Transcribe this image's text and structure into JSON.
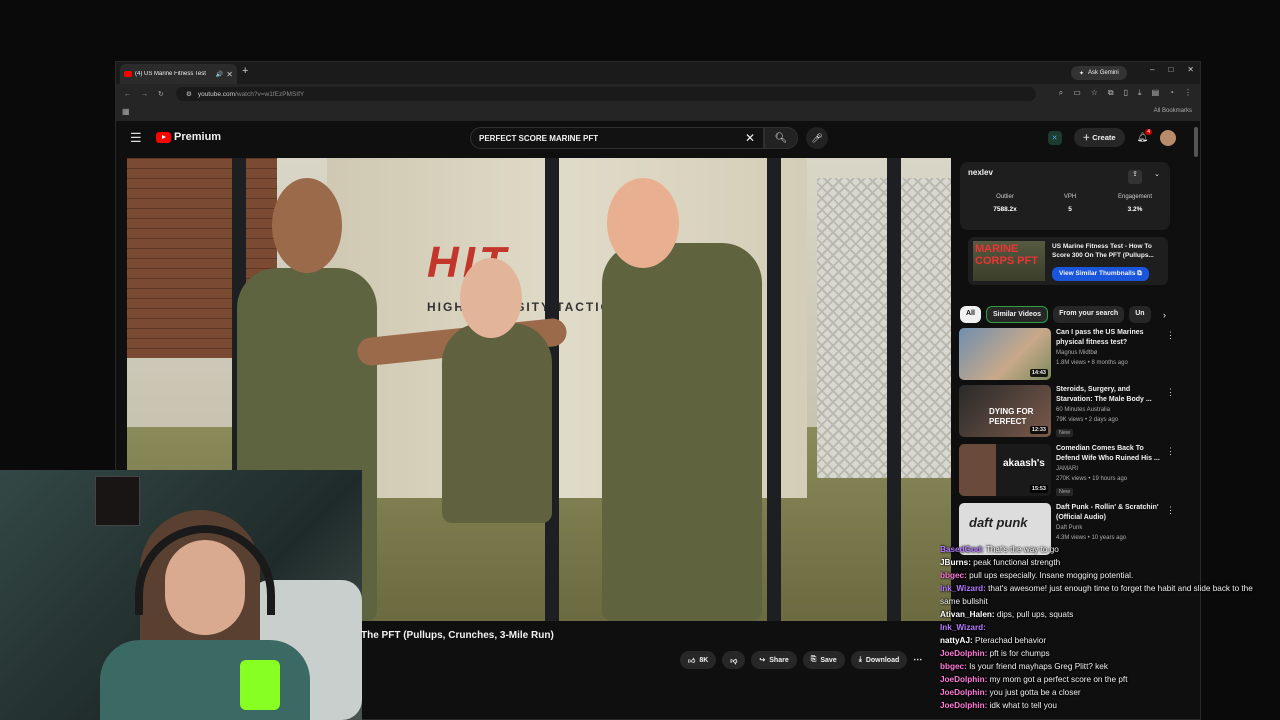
{
  "browser": {
    "tab_title": "(4) US Marine Fitness Test",
    "new_tab": "+",
    "gemini": "Ask Gemini",
    "url_host": "youtube.com",
    "url_path": "/watch?v=w1fEzPMSIfY",
    "all_bookmarks": "All Bookmarks",
    "window_controls": [
      "–",
      "□",
      "✕"
    ]
  },
  "youtube": {
    "logo": "Premium",
    "search_value": "PERFECT SCORE MARINE PFT",
    "create_label": "Create",
    "notif_count": "4",
    "video_title": "The PFT (Pullups, Crunches, 3-Mile Run)",
    "wall_text": "HIT",
    "wall_subtext": "HIGH INTENSITY TACTICAL",
    "actions": {
      "like": "8K",
      "share": "Share",
      "save": "Save",
      "download": "Download"
    }
  },
  "extension": {
    "logo": "nexlev",
    "stats": [
      {
        "label": "Outlier",
        "value": "7588.2x"
      },
      {
        "label": "VPH",
        "value": "5"
      },
      {
        "label": "Engagement",
        "value": "3.2%"
      }
    ],
    "similar": {
      "thumb_text": "MARINE CORPS PFT",
      "title": "US Marine Fitness Test - How To Score 300 On The PFT (Pullups...",
      "button": "View Similar Thumbnails"
    }
  },
  "chips": [
    "All",
    "Similar Videos",
    "From your search",
    "Un"
  ],
  "recommendations": [
    {
      "title": "Can I pass the US Marines physical fitness test?",
      "channel": "Magnus Midtbø",
      "meta": "1.8M views • 8 months ago",
      "duration": "14:43",
      "thumb_text": "",
      "new": ""
    },
    {
      "title": "Steroids, Surgery, and Starvation: The Male Body ...",
      "channel": "60 Minutes Australia",
      "meta": "79K views • 2 days ago",
      "duration": "12:33",
      "thumb_text": "DYING FOR PERFECT",
      "new": "New"
    },
    {
      "title": "Comedian Comes Back To Defend Wife Who Ruined His ...",
      "channel": "JAMARI",
      "meta": "270K views • 19 hours ago",
      "duration": "15:53",
      "thumb_text": "akaash's",
      "new": "New"
    },
    {
      "title": "Daft Punk - Rollin' & Scratchin' (Official Audio)",
      "channel": "Daft Punk",
      "meta": "4.3M views • 10 years ago",
      "duration": "",
      "thumb_text": "daft punk",
      "new": ""
    }
  ],
  "chat": [
    {
      "name": "BasedGod",
      "text": "That's the way to go",
      "color": "#b67bff"
    },
    {
      "name": "JBurns",
      "text": "peak functional strength",
      "color": "#ffffff"
    },
    {
      "name": "bbgec",
      "text": "pull ups especially. Insane mogging potential.",
      "color": "#ff7ad9"
    },
    {
      "name": "Ink_Wizard",
      "text": "that's awesome! just enough time to forget the habit and slide back to the same bullshit",
      "color": "#b67bff"
    },
    {
      "name": "Ativan_Halen",
      "text": "dips, pull ups, squats",
      "color": "#ffffff"
    },
    {
      "name": "Ink_Wizard",
      "text": "",
      "color": "#b67bff"
    },
    {
      "name": "nattyAJ",
      "text": "Pterachad behavior",
      "color": "#ffffff"
    },
    {
      "name": "JoeDolphin",
      "text": "pft is for chumps",
      "color": "#ff7ad9"
    },
    {
      "name": "bbgec",
      "text": "Is your friend mayhaps Greg Plitt? kek",
      "color": "#ff7ad9"
    },
    {
      "name": "JoeDolphin",
      "text": "my mom got a perfect score on the pft",
      "color": "#ff7ad9"
    },
    {
      "name": "JoeDolphin",
      "text": "you just gotta be a closer",
      "color": "#ff7ad9"
    },
    {
      "name": "JoeDolphin",
      "text": "idk what to tell you",
      "color": "#ff7ad9"
    }
  ]
}
